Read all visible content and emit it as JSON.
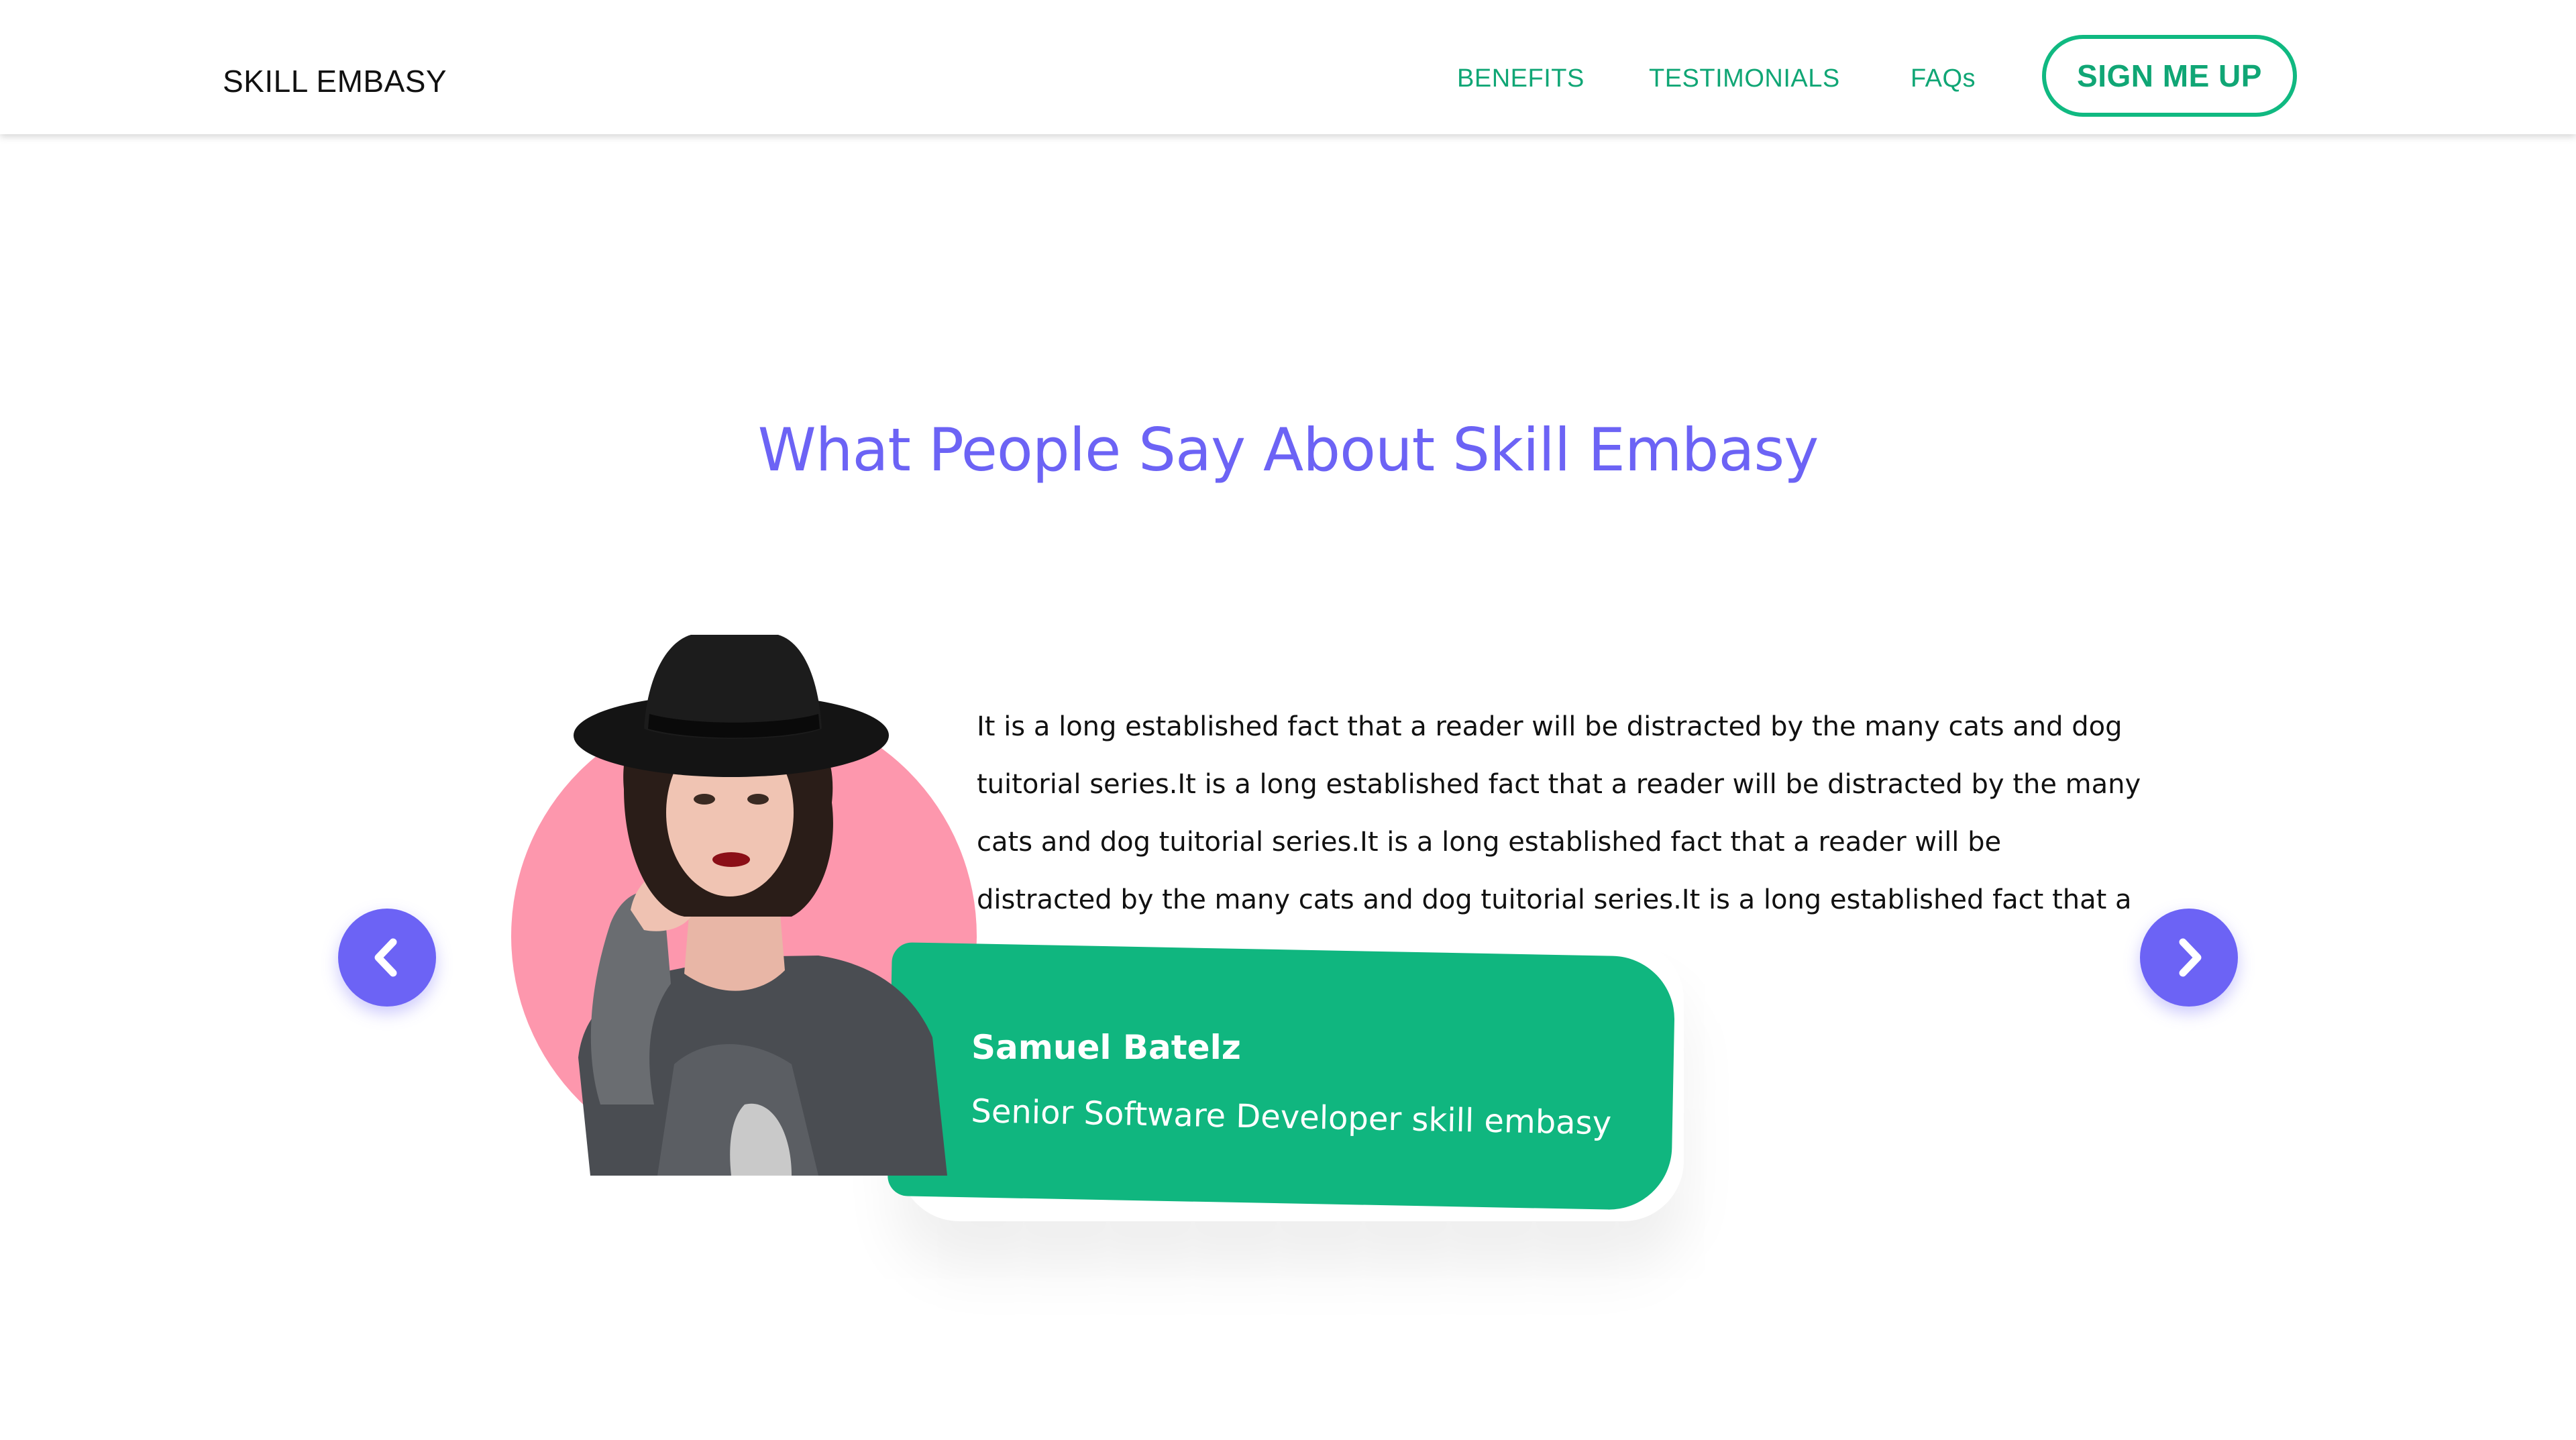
{
  "header": {
    "brand": "SKILL EMBASY",
    "nav": [
      {
        "label": "BENEFITS"
      },
      {
        "label": "TESTIMONIALS"
      },
      {
        "label": "FAQs"
      }
    ],
    "cta_label": "SIGN ME UP"
  },
  "testimonials": {
    "title": "What People Say About Skill Embasy",
    "quote_lines": [
      "It is a long established fact that a reader will be distracted by the many cats and dog",
      "tuitorial series.It is a long established fact that a reader will be distracted by the many",
      "cats and dog tuitorial series.It is a long established fact that a reader will be",
      "distracted by the many cats and dog tuitorial series.It is a long established fact that a"
    ],
    "person_name": "Samuel Batelz",
    "person_role": "Senior Software Developer skill embasy",
    "prev_icon": "chevron-left-icon",
    "next_icon": "chevron-right-icon"
  },
  "colors": {
    "accent": "#10b981",
    "title": "#6c63f5",
    "circle": "#fd97ad"
  }
}
